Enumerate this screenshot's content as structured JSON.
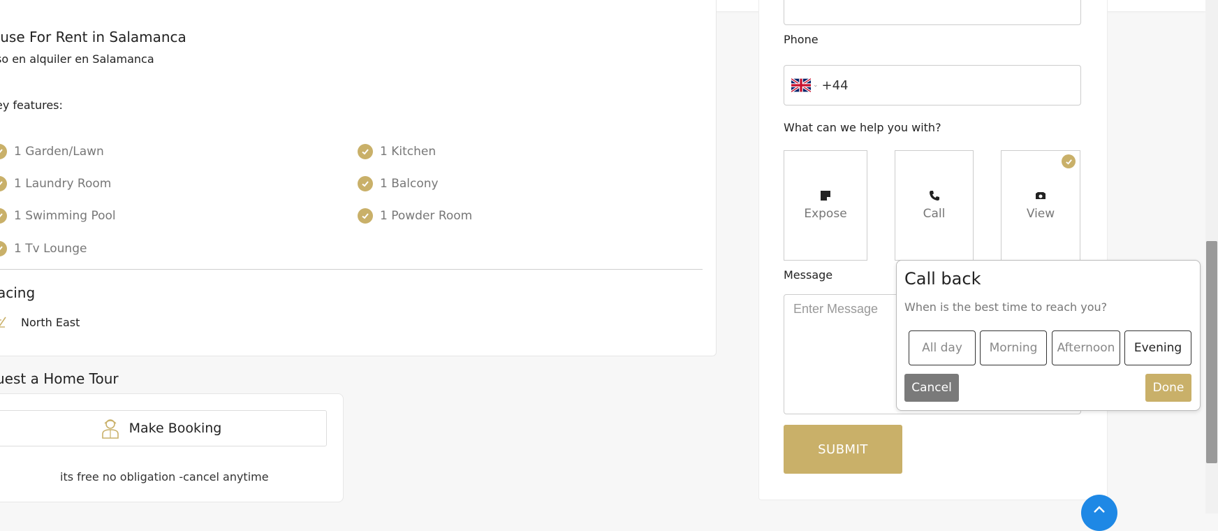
{
  "listing": {
    "title": "ouse For Rent in Salamanca",
    "subtitle": "so en alquiler en Salamanca",
    "key_features_label": "ey features:",
    "features_left": [
      "1 Garden/Lawn",
      "1 Laundry Room",
      "1 Swimming Pool",
      "1 Tv Lounge"
    ],
    "features_right": [
      "1 Kitchen",
      "1 Balcony",
      "1 Powder Room"
    ],
    "facing_label": "acing",
    "facing_value": "North East"
  },
  "tour": {
    "title": "uest a Home Tour",
    "book_label": "Make Booking",
    "note": "its free no obligation -cancel anytime"
  },
  "form": {
    "phone_label": "Phone",
    "phone_prefix": "+44",
    "help_label": "What can we help you with?",
    "options": [
      {
        "label": "Expose",
        "icon": "note-icon",
        "selected": false
      },
      {
        "label": "Call",
        "icon": "phone-icon",
        "selected": false
      },
      {
        "label": "View",
        "icon": "eye-icon",
        "selected": true
      }
    ],
    "message_label": "Message",
    "message_placeholder": "Enter Message",
    "submit_label": "SUBMIT"
  },
  "callback_popup": {
    "title": "Call back",
    "subtitle": "When is the best time to reach you?",
    "times": [
      "All day",
      "Morning",
      "Afternoon",
      "Evening"
    ],
    "selected_time": "Evening",
    "cancel_label": "Cancel",
    "done_label": "Done"
  },
  "colors": {
    "accent": "#c9b069",
    "cancel": "#7a7a7a",
    "scroll_top": "#1e88e5"
  }
}
